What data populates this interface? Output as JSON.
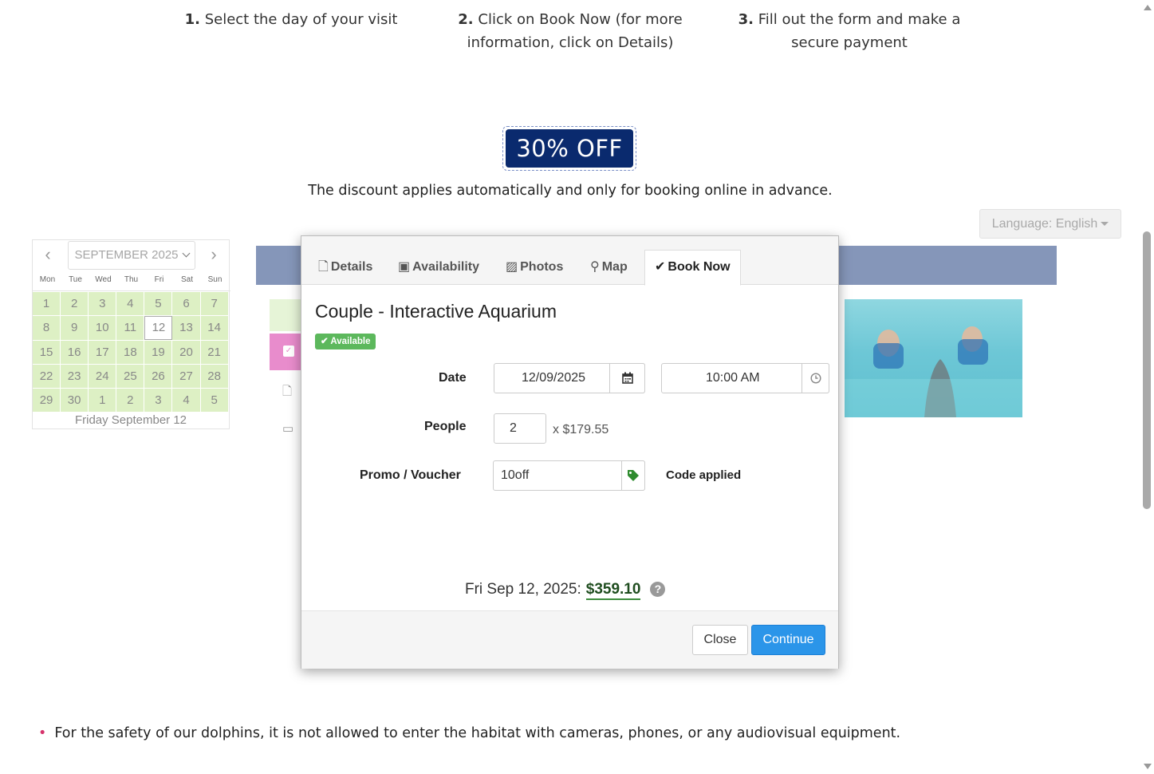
{
  "steps": [
    {
      "num": "1.",
      "text_line1": "Select the day of your visit",
      "text_line2": ""
    },
    {
      "num": "2.",
      "text_line1": "Click on Book Now (for more",
      "text_line2": "information, click on Details)"
    },
    {
      "num": "3.",
      "text_line1": "Fill out the form and make a",
      "text_line2": "secure payment"
    }
  ],
  "promo": {
    "badge": "30% OFF",
    "note": "The discount applies automatically and only for booking online in advance."
  },
  "language": {
    "label": "Language: English"
  },
  "calendar": {
    "month": "SEPTEMBER 2025",
    "weekdays": [
      "Mon",
      "Tue",
      "Wed",
      "Thu",
      "Fri",
      "Sat",
      "Sun"
    ],
    "weeks": [
      [
        "1",
        "2",
        "3",
        "4",
        "5",
        "6",
        "7"
      ],
      [
        "8",
        "9",
        "10",
        "11",
        "12",
        "13",
        "14"
      ],
      [
        "15",
        "16",
        "17",
        "18",
        "19",
        "20",
        "21"
      ],
      [
        "22",
        "23",
        "24",
        "25",
        "26",
        "27",
        "28"
      ],
      [
        "29",
        "30",
        "1",
        "2",
        "3",
        "4",
        "5"
      ]
    ],
    "selected": "12",
    "footer": "Friday September 12"
  },
  "modal": {
    "tabs": [
      {
        "icon": "file-icon",
        "label": "Details"
      },
      {
        "icon": "calendar-icon",
        "label": "Availability"
      },
      {
        "icon": "image-icon",
        "label": "Photos"
      },
      {
        "icon": "map-marker-icon",
        "label": "Map"
      },
      {
        "icon": "check-icon",
        "label": "Book Now"
      }
    ],
    "title": "Couple - Interactive Aquarium",
    "badge": "Available",
    "date_label": "Date",
    "date_value": "12/09/2025",
    "time_value": "10:00 AM",
    "people_label": "People",
    "people_value": "2",
    "unit_price": "x $179.55",
    "promo_label": "Promo / Voucher",
    "promo_value": "10off",
    "promo_status": "Code applied",
    "summary_date": "Fri Sep 12, 2025:",
    "summary_total": "$359.10",
    "help": "?",
    "close_label": "Close",
    "continue_label": "Continue"
  },
  "notes": {
    "bullet1": "For the safety of our dolphins, it is not allowed to enter the habitat with cameras, phones, or any audiovisual equipment."
  },
  "colors": {
    "accent": "#2b95e9",
    "promo_bg": "#0a2a6e",
    "available": "#5cb85c",
    "calendar_available": "#ddf0c4",
    "banner": "#8596b9"
  }
}
